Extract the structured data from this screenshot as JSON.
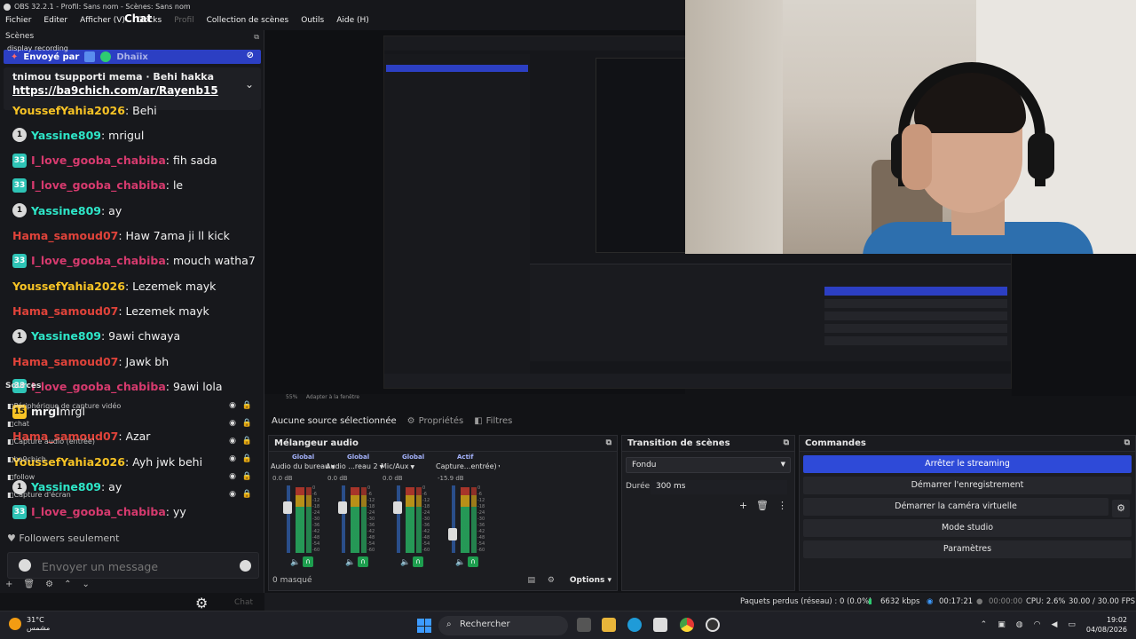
{
  "window": {
    "title": "OBS 32.2.1 - Profil: Sans nom - Scènes: Sans nom",
    "menu": [
      "Fichier",
      "Editer",
      "Afficher (V)",
      "Docks",
      "Profil",
      "Collection de scènes",
      "Outils",
      "Aide (H)"
    ],
    "chat_title": "Chat"
  },
  "chat": {
    "scenes_label": "Scènes",
    "recording_label": "display recording",
    "sent_by": "Envoyé par",
    "sent_user": "Dhaïix",
    "pinned_user": "tnimou",
    "pinned_text": "tsupporti mema · Behi hakka",
    "pinned_link": "https://ba9chich.com/ar/Rayenb15",
    "messages": [
      {
        "badge": "",
        "user": "YoussefYahia2026",
        "text": ": Behi",
        "color": "#f7c325"
      },
      {
        "badge": "1",
        "user": "Yassine809",
        "text": ": mrigul",
        "color": "#2ee6c8"
      },
      {
        "badge": "33",
        "user": "I_love_gooba_chabiba",
        "text": ": fih sada",
        "color": "#d63a6e"
      },
      {
        "badge": "33",
        "user": "I_love_gooba_chabiba",
        "text": ": le",
        "color": "#d63a6e"
      },
      {
        "badge": "1",
        "user": "Yassine809",
        "text": ": ay",
        "color": "#2ee6c8"
      },
      {
        "badge": "",
        "user": "Hama_samoud07",
        "text": ": Haw 7ama ji ll kick",
        "color": "#e0433a"
      },
      {
        "badge": "33",
        "user": "I_love_gooba_chabiba",
        "text": ": mouch watha7",
        "color": "#d63a6e"
      },
      {
        "badge": "",
        "user": "YoussefYahia2026",
        "text": ": Lezemek mayk",
        "color": "#f7c325"
      },
      {
        "badge": "",
        "user": "Hama_samoud07",
        "text": ": Lezemek mayk",
        "color": "#e0433a"
      },
      {
        "badge": "1",
        "user": "Yassine809",
        "text": ": 9awi chwaya",
        "color": "#2ee6c8"
      },
      {
        "badge": "",
        "user": "Hama_samoud07",
        "text": ": Jawk bh",
        "color": "#e0433a"
      },
      {
        "badge": "33",
        "user": "I_love_gooba_chabiba",
        "text": ": 9awi lola",
        "color": "#d63a6e"
      },
      {
        "badge": "15",
        "user": "mrgl",
        "text": " mrgl",
        "color": "#f0f0f0"
      },
      {
        "badge": "",
        "user": "Hama_samoud07",
        "text": ": Azar",
        "color": "#e0433a"
      },
      {
        "badge": "",
        "user": "YoussefYahia2026",
        "text": ": Ayh jwk behi",
        "color": "#f7c325"
      },
      {
        "badge": "1",
        "user": "Yassine809",
        "text": ": ay",
        "color": "#2ee6c8"
      },
      {
        "badge": "33",
        "user": "I_love_gooba_chabiba",
        "text": ": yy",
        "color": "#d63a6e"
      }
    ],
    "sources_label": "Sources",
    "sources": [
      "Périphérique de capture vidéo",
      "chat",
      "Capture audio (entrée)",
      "ba9chich",
      "follow",
      "Capture d'écran"
    ],
    "followers_only": "Followers seulement",
    "input_placeholder": "Envoyer un message",
    "ghost_chat": "Chat"
  },
  "preview": {
    "zoom": "55%",
    "fit": "Adapter à la fenêtre"
  },
  "tabs": {
    "no_source": "Aucune source sélectionnée",
    "properties": "Propriétés",
    "filters": "Filtres"
  },
  "mixer": {
    "title": "Mélangeur audio",
    "channels": [
      {
        "scope": "Global",
        "name": "Audio du bureau",
        "db": "0.0 dB"
      },
      {
        "scope": "Global",
        "name": "Audio ...reau 2",
        "db": "0.0 dB"
      },
      {
        "scope": "Global",
        "name": "Mic/Aux",
        "db": "0.0 dB"
      },
      {
        "scope": "Actif",
        "name": "Capture...entrée)",
        "db": "-15.9 dB"
      }
    ],
    "scale": [
      "0",
      "-6",
      "-12",
      "-18",
      "-24",
      "-30",
      "-36",
      "-42",
      "-48",
      "-54",
      "-60"
    ],
    "hidden": "0 masqué",
    "options": "Options"
  },
  "transitions": {
    "title": "Transition de scènes",
    "selected": "Fondu",
    "duration_label": "Durée",
    "duration_value": "300 ms"
  },
  "commands": {
    "title": "Commandes",
    "buttons": [
      "Arrêter le streaming",
      "Démarrer l'enregistrement",
      "Démarrer la caméra virtuelle",
      "Mode studio",
      "Paramètres"
    ]
  },
  "status": {
    "dropped": "Paquets perdus (réseau) : 0 (0.0%)",
    "bitrate": "6632 kbps",
    "stream_time": "00:17:21",
    "rec_time": "00:00:00",
    "cpu": "CPU: 2.6%",
    "fps": "30.00 / 30.00 FPS"
  },
  "taskbar": {
    "temp": "31°C",
    "weather": "مشمس",
    "search": "Rechercher",
    "time": "19:02",
    "date": "04/08/2026"
  },
  "colors": {
    "accent": "#2e4ad8",
    "panel": "#1c1d21",
    "background": "#121316"
  }
}
